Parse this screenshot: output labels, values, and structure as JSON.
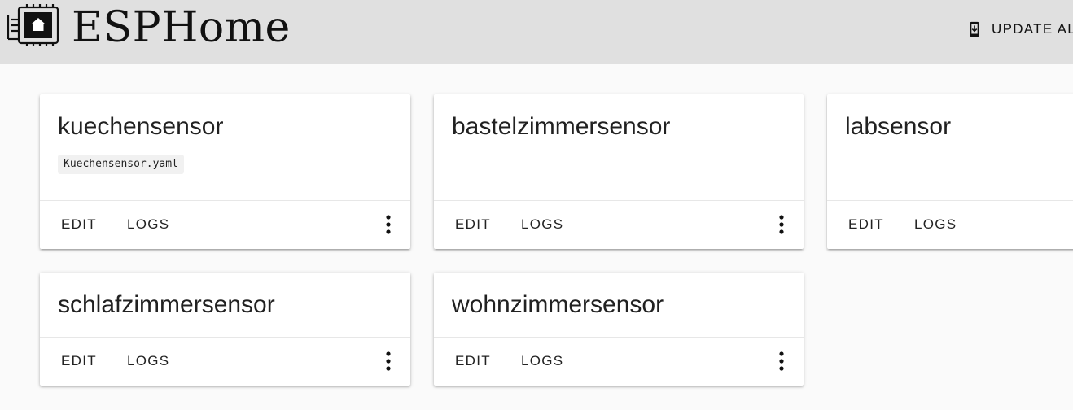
{
  "header": {
    "brand": "ESPHome",
    "update_all_label": "UPDATE AL",
    "background": "#e0e0e0"
  },
  "devices": [
    {
      "name": "kuechensensor",
      "file": "Kuechensensor.yaml",
      "edit_label": "EDIT",
      "logs_label": "LOGS",
      "more_icon": "more-vert-icon"
    },
    {
      "name": "bastelzimmersensor",
      "edit_label": "EDIT",
      "logs_label": "LOGS",
      "more_icon": "more-vert-icon"
    },
    {
      "name": "labsensor",
      "edit_label": "EDIT",
      "logs_label": "LOGS"
    },
    {
      "name": "schlafzimmersensor",
      "edit_label": "EDIT",
      "logs_label": "LOGS",
      "more_icon": "more-vert-icon"
    },
    {
      "name": "wohnzimmersensor",
      "edit_label": "EDIT",
      "logs_label": "LOGS",
      "more_icon": "more-vert-icon"
    }
  ],
  "colors": {
    "page_background": "#fafafa",
    "card_background": "#ffffff",
    "text": "#212121"
  }
}
